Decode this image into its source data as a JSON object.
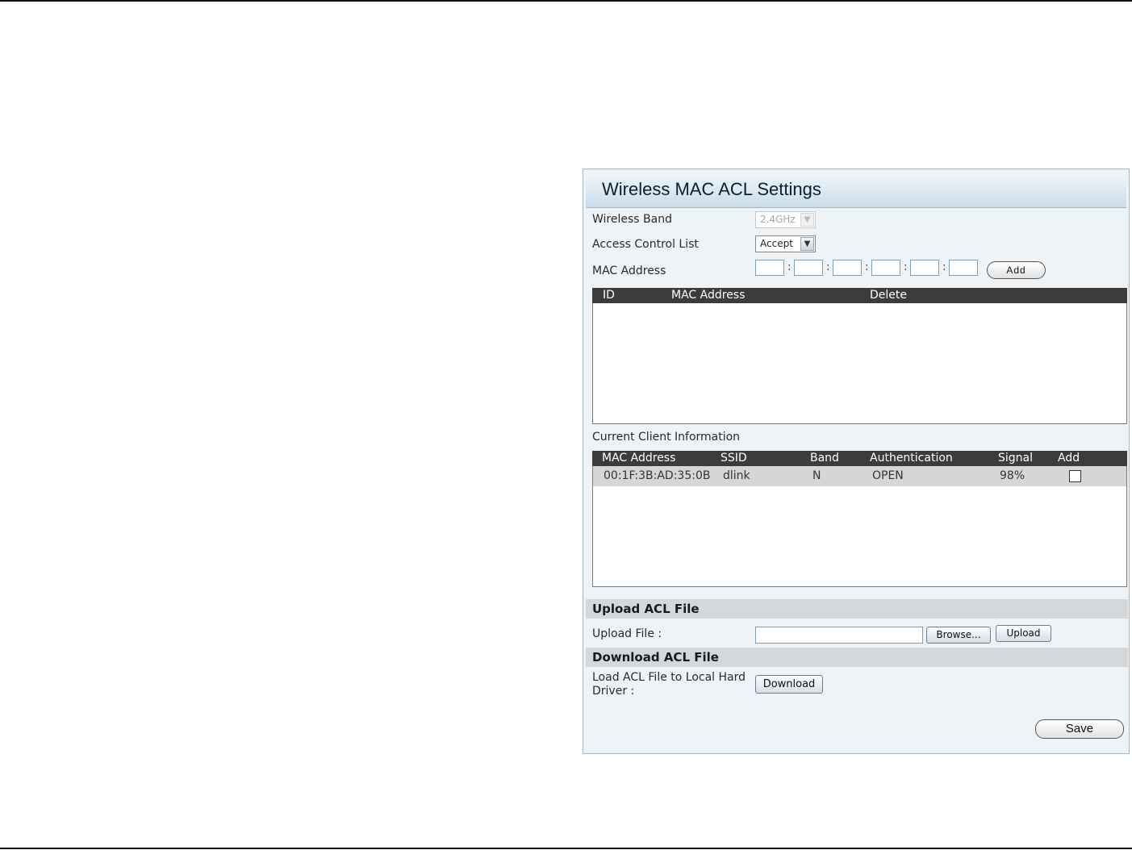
{
  "panel": {
    "title": "Wireless MAC ACL Settings"
  },
  "form": {
    "wireless_band_label": "Wireless Band",
    "wireless_band_value": "2.4GHz",
    "acl_label": "Access Control List",
    "acl_value": "Accept",
    "mac_label": "MAC Address",
    "mac_octets": [
      "",
      "",
      "",
      "",
      "",
      ""
    ],
    "add_label": "Add"
  },
  "acl_table": {
    "headers": [
      "ID",
      "MAC Address",
      "Delete"
    ],
    "rows": []
  },
  "clients": {
    "title": "Current Client Information",
    "headers": [
      "MAC Address",
      "SSID",
      "Band",
      "Authentication",
      "Signal",
      "Add"
    ],
    "rows": [
      {
        "mac": "00:1F:3B:AD:35:0B",
        "ssid": "dlink",
        "band": "N",
        "auth": "OPEN",
        "signal": "98%",
        "checked": false
      }
    ]
  },
  "upload": {
    "section_title": "Upload ACL File",
    "file_label": "Upload File :",
    "browse_label": "Browse...",
    "upload_label": "Upload"
  },
  "download": {
    "section_title": "Download ACL File",
    "label_line1": "Load ACL File to Local Hard",
    "label_line2": "Driver :",
    "download_label": "Download"
  },
  "save_label": "Save"
}
